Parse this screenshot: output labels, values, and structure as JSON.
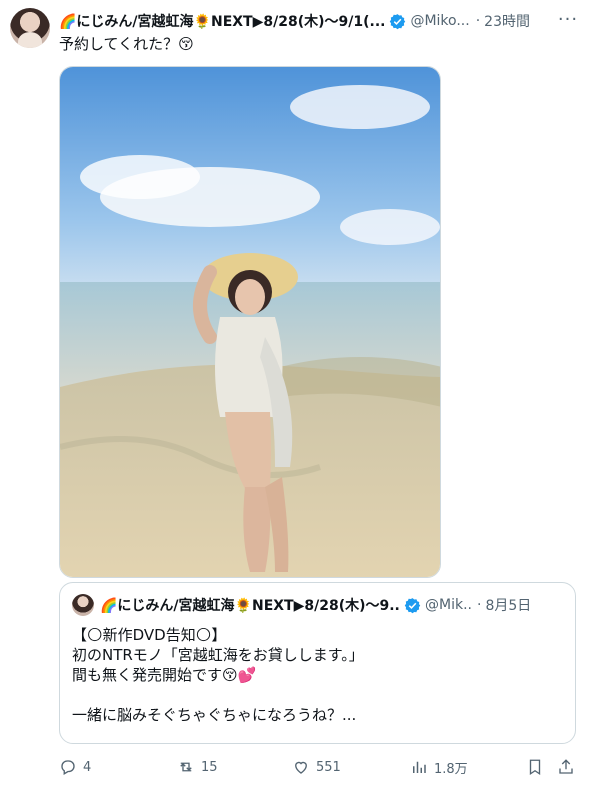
{
  "tweet": {
    "display_name": "🌈にじみん/宮越虹海🌻NEXT▶8/28(木)〜9/1(...",
    "handle": "@Miko...",
    "separator": "·",
    "time": "23時間",
    "more_label": "···",
    "text": "予約してくれた？😚"
  },
  "quote": {
    "display_name": "🌈にじみん/宮越虹海🌻NEXT▶8/28(木)〜9...",
    "handle": "@Mik...",
    "separator": "·",
    "date": "8月5日",
    "lines": [
      "【🌕新作DVD告知🌕】",
      "初のNTRモノ「宮越虹海をお貸しします。」",
      "間も無く発売開始です😚💕",
      "",
      "一緒に脳みそぐちゃぐちゃになろうね？..."
    ]
  },
  "actions": {
    "replies": "4",
    "reposts": "15",
    "likes": "551",
    "views": "1.8万"
  },
  "colors": {
    "verified": "#1d9bf0",
    "muted": "#536471",
    "text": "#0f1419",
    "border": "#cfd9de"
  }
}
